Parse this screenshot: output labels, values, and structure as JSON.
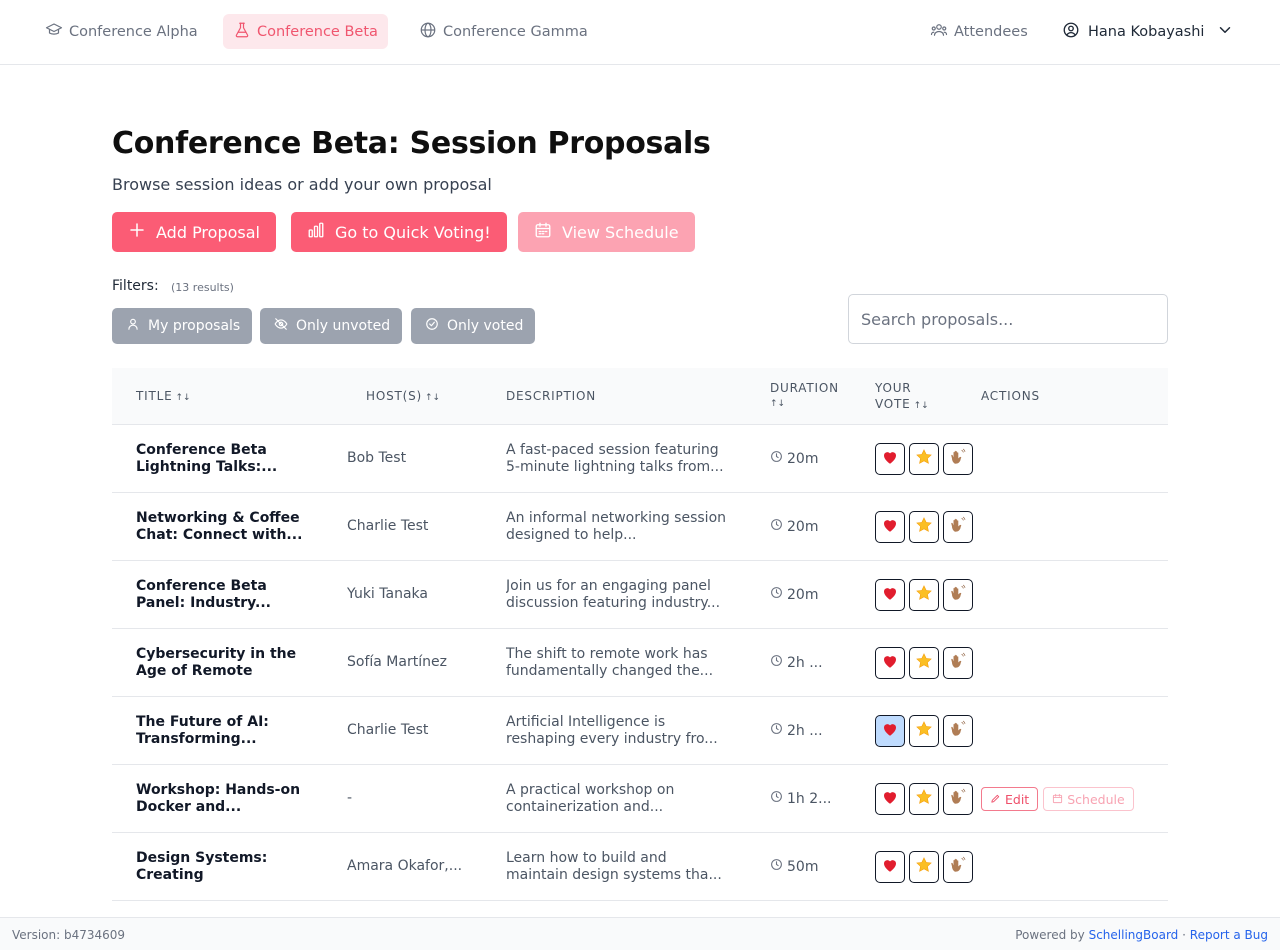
{
  "nav": {
    "tabs": [
      {
        "label": "Conference Alpha",
        "icon": "graduation-cap-icon"
      },
      {
        "label": "Conference Beta",
        "icon": "flask-icon"
      },
      {
        "label": "Conference Gamma",
        "icon": "globe-icon"
      }
    ],
    "attendees_label": "Attendees",
    "user_name": "Hana Kobayashi",
    "accent_color": "#f0566f"
  },
  "header": {
    "title": "Conference Beta: Session Proposals",
    "subtitle": "Browse session ideas or add your own proposal"
  },
  "actions": {
    "add_label": "Add Proposal",
    "quick_vote_label": "Go to Quick Voting!",
    "schedule_label": "View Schedule"
  },
  "filters": {
    "label": "Filters:",
    "count": "(13 results)",
    "my_proposals": "My proposals",
    "only_unvoted": "Only unvoted",
    "only_voted": "Only voted"
  },
  "search": {
    "placeholder": "Search proposals..."
  },
  "table": {
    "headers": {
      "title": "Title",
      "hosts": "Host(s)",
      "description": "Description",
      "duration_1": "Duration",
      "vote_1": "Your",
      "vote_2": "Vote",
      "actions": "Actions",
      "sort": "↑↓"
    },
    "rows": [
      {
        "title": "Conference Beta Lightning Talks:...",
        "host": "Bob Test",
        "desc": "A fast-paced session featuring 5-minute lightning talks from...",
        "dur": "20m",
        "vote_selected": ""
      },
      {
        "title": "Networking & Coffee Chat: Connect with...",
        "host": "Charlie Test",
        "desc": "An informal networking session designed to help...",
        "dur": "20m",
        "vote_selected": ""
      },
      {
        "title": "Conference Beta Panel: Industry...",
        "host": "Yuki Tanaka",
        "desc": "Join us for an engaging panel discussion featuring industry...",
        "dur": "20m",
        "vote_selected": ""
      },
      {
        "title": "Cybersecurity in the Age of Remote Work:...",
        "host": "Sofía Martínez",
        "desc": "The shift to remote work has fundamentally changed the...",
        "dur": "2h ...",
        "vote_selected": ""
      },
      {
        "title": "The Future of AI: Transforming...",
        "host": "Charlie Test",
        "desc": "Artificial Intelligence is reshaping every industry fro...",
        "dur": "2h ...",
        "vote_selected": "heart"
      },
      {
        "title": "Workshop: Hands-on Docker and...",
        "host": "-",
        "desc": "A practical workshop on containerization and...",
        "dur": "1h 2...",
        "vote_selected": "",
        "edit_label": "Edit",
        "schedule_label": "Schedule"
      },
      {
        "title": "Design Systems: Creating Consistency...",
        "host": "Amara Okafor,...",
        "desc": "Learn how to build and maintain design systems tha...",
        "dur": "50m",
        "vote_selected": ""
      }
    ]
  },
  "footer": {
    "version": "Version: b4734609",
    "powered_by": "Powered by",
    "brand": "SchellingBoard",
    "separator": "·",
    "report": "Report a Bug"
  }
}
